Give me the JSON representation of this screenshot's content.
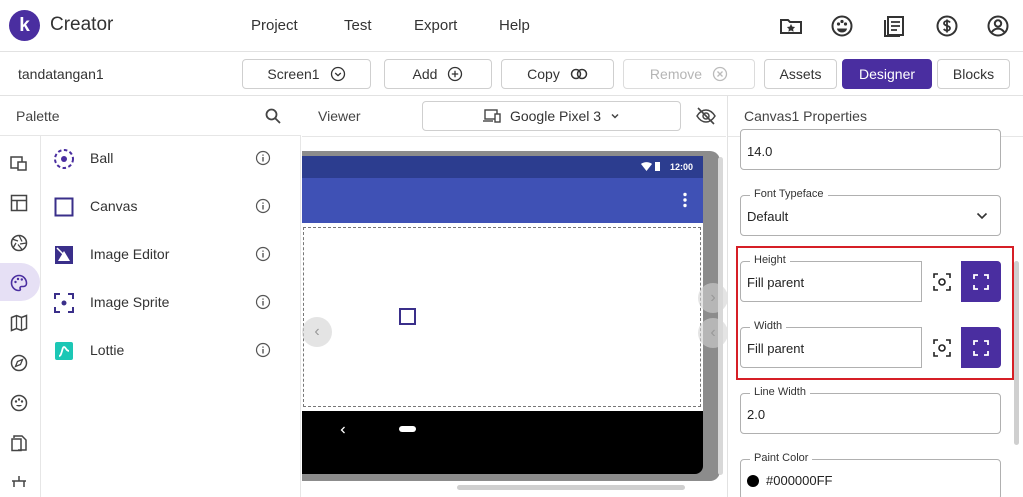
{
  "app": {
    "name": "Creator",
    "logo_letter": "k",
    "brand_color": "#4a2ea0"
  },
  "menu": {
    "items": [
      "Project",
      "Test",
      "Export",
      "Help"
    ]
  },
  "top_icons": [
    "folder-star-icon",
    "gallery-icon",
    "guide-icon",
    "dollar-icon",
    "account-icon"
  ],
  "toolbar": {
    "project_name": "tandatangan1",
    "screen_label": "Screen1",
    "add_label": "Add",
    "copy_label": "Copy",
    "remove_label": "Remove",
    "assets_label": "Assets",
    "designer_label": "Designer",
    "blocks_label": "Blocks"
  },
  "palette": {
    "title": "Palette",
    "items": [
      {
        "label": "Ball",
        "icon": "ball-icon"
      },
      {
        "label": "Canvas",
        "icon": "canvas-icon"
      },
      {
        "label": "Image Editor",
        "icon": "image-editor-icon"
      },
      {
        "label": "Image Sprite",
        "icon": "image-sprite-icon"
      },
      {
        "label": "Lottie",
        "icon": "lottie-icon"
      }
    ]
  },
  "viewer": {
    "title": "Viewer",
    "device": "Google Pixel 3",
    "status_time": "12:00"
  },
  "properties": {
    "title": "Canvas1 Properties",
    "font_size_value": "14.0",
    "font_typeface": {
      "label": "Font Typeface",
      "value": "Default"
    },
    "height": {
      "label": "Height",
      "value": "Fill parent"
    },
    "width": {
      "label": "Width",
      "value": "Fill parent"
    },
    "line_width": {
      "label": "Line Width",
      "value": "2.0"
    },
    "paint_color": {
      "label": "Paint Color",
      "value": "#000000FF"
    }
  },
  "colors": {
    "accent": "#4a2ea0",
    "app_bar": "#3f51b5",
    "status_bar": "#2c3d8f",
    "highlight": "#d61f26"
  }
}
